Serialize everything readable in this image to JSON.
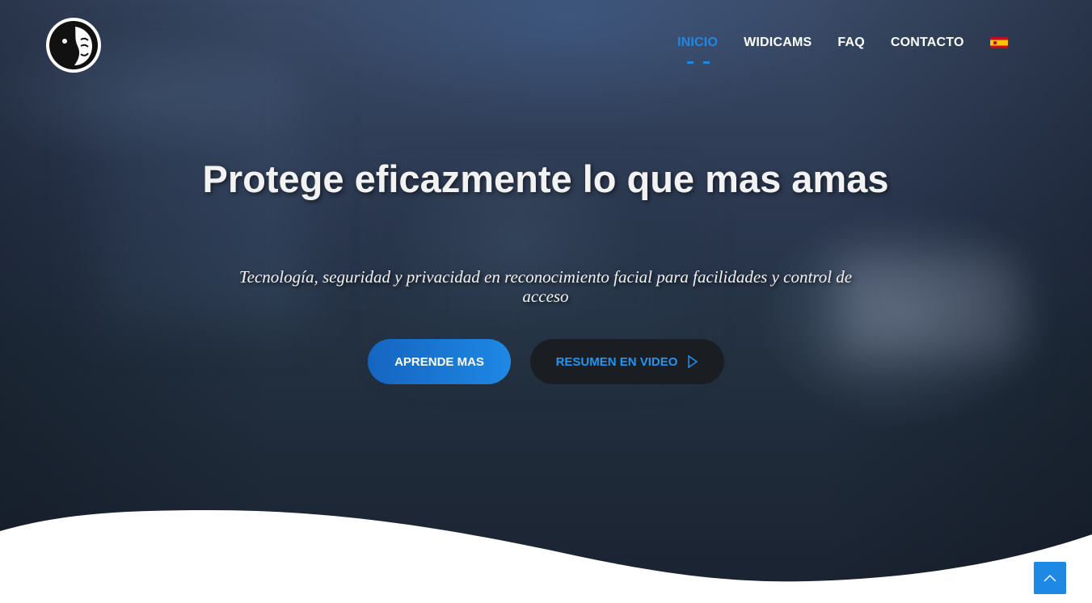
{
  "nav": {
    "items": [
      {
        "label": "INICIO",
        "active": true
      },
      {
        "label": "WIDICAMS",
        "active": false
      },
      {
        "label": "FAQ",
        "active": false
      },
      {
        "label": "CONTACTO",
        "active": false
      }
    ],
    "language_icon": "spain-flag-icon"
  },
  "hero": {
    "title": "Protege eficazmente lo que mas amas",
    "subtitle": "Tecnología, seguridad y privacidad en reconocimiento facial para facilidades y control de acceso",
    "primary_button": "APRENDE MAS",
    "video_button": "RESUMEN EN VIDEO",
    "video_icon": "play-icon"
  },
  "colors": {
    "accent": "#1e88e5",
    "video_button_bg": "#1a1d22"
  },
  "scroll_top_icon": "chevron-up-icon"
}
